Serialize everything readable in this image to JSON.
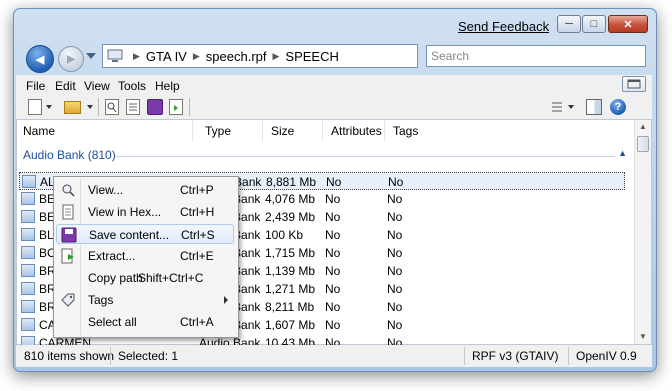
{
  "titlebar": {
    "feedback_link": "Send Feedback",
    "minimize": "─",
    "maximize": "□",
    "close": "✕"
  },
  "navigation": {
    "back_glyph": "◀",
    "forward_glyph": "▶",
    "breadcrumb": [
      "GTA IV",
      "speech.rpf",
      "SPEECH"
    ],
    "search_placeholder": "Search"
  },
  "menubar": [
    "File",
    "Edit",
    "View",
    "Tools",
    "Help"
  ],
  "columns": [
    "Name",
    "Type",
    "Size",
    "Attributes",
    "Tags"
  ],
  "group": {
    "label": "Audio Bank (810)",
    "chevron": "▲"
  },
  "rows": [
    {
      "name": "ALEX",
      "type": "Audio Bank",
      "size": "8,881 Mb",
      "attributes": "No",
      "tags": "No",
      "selected": true
    },
    {
      "name": "BE",
      "type": "Audio Bank",
      "size": "4,076 Mb",
      "attributes": "No",
      "tags": "No"
    },
    {
      "name": "BE",
      "type": "Audio Bank",
      "size": "2,439 Mb",
      "attributes": "No",
      "tags": "No"
    },
    {
      "name": "BL",
      "type": "Audio Bank",
      "size": "100 Kb",
      "attributes": "No",
      "tags": "No"
    },
    {
      "name": "BC",
      "type": "Audio Bank",
      "size": "1,715 Mb",
      "attributes": "No",
      "tags": "No"
    },
    {
      "name": "BR",
      "type": "Audio Bank",
      "size": "1,139 Mb",
      "attributes": "No",
      "tags": "No"
    },
    {
      "name": "BR",
      "type": "Audio Bank",
      "size": "1,271 Mb",
      "attributes": "No",
      "tags": "No"
    },
    {
      "name": "BR",
      "type": "Audio Bank",
      "size": "8,211 Mb",
      "attributes": "No",
      "tags": "No"
    },
    {
      "name": "CA",
      "type": "Audio Bank",
      "size": "1,607 Mb",
      "attributes": "No",
      "tags": "No"
    },
    {
      "name": "CARMEN",
      "type": "Audio Bank",
      "size": "10,43 Mb",
      "attributes": "No",
      "tags": "No"
    }
  ],
  "context_menu": [
    {
      "label": "View...",
      "shortcut": "Ctrl+P",
      "icon": "search-icon"
    },
    {
      "label": "View in Hex...",
      "shortcut": "Ctrl+H",
      "icon": "document-icon"
    },
    {
      "label": "Save content...",
      "shortcut": "Ctrl+S",
      "icon": "floppy-icon",
      "highlighted": true
    },
    {
      "label": "Extract...",
      "shortcut": "Ctrl+E",
      "icon": "extract-icon"
    },
    {
      "label": "Copy path",
      "shortcut": "Shift+Ctrl+C",
      "icon": ""
    },
    {
      "label": "Tags",
      "shortcut": "",
      "icon": "tag-icon",
      "submenu": true
    },
    {
      "label": "Select all",
      "shortcut": "Ctrl+A",
      "icon": ""
    }
  ],
  "statusbar": {
    "items_shown": "810 items shown",
    "selected": "Selected: 1",
    "format": "RPF v3 (GTAIV)",
    "app": "OpenIV 0.9"
  },
  "colors": {
    "accent": "#1e4fa0",
    "selection": "#e8f1fb",
    "window_chrome": "#b9d1ea"
  }
}
